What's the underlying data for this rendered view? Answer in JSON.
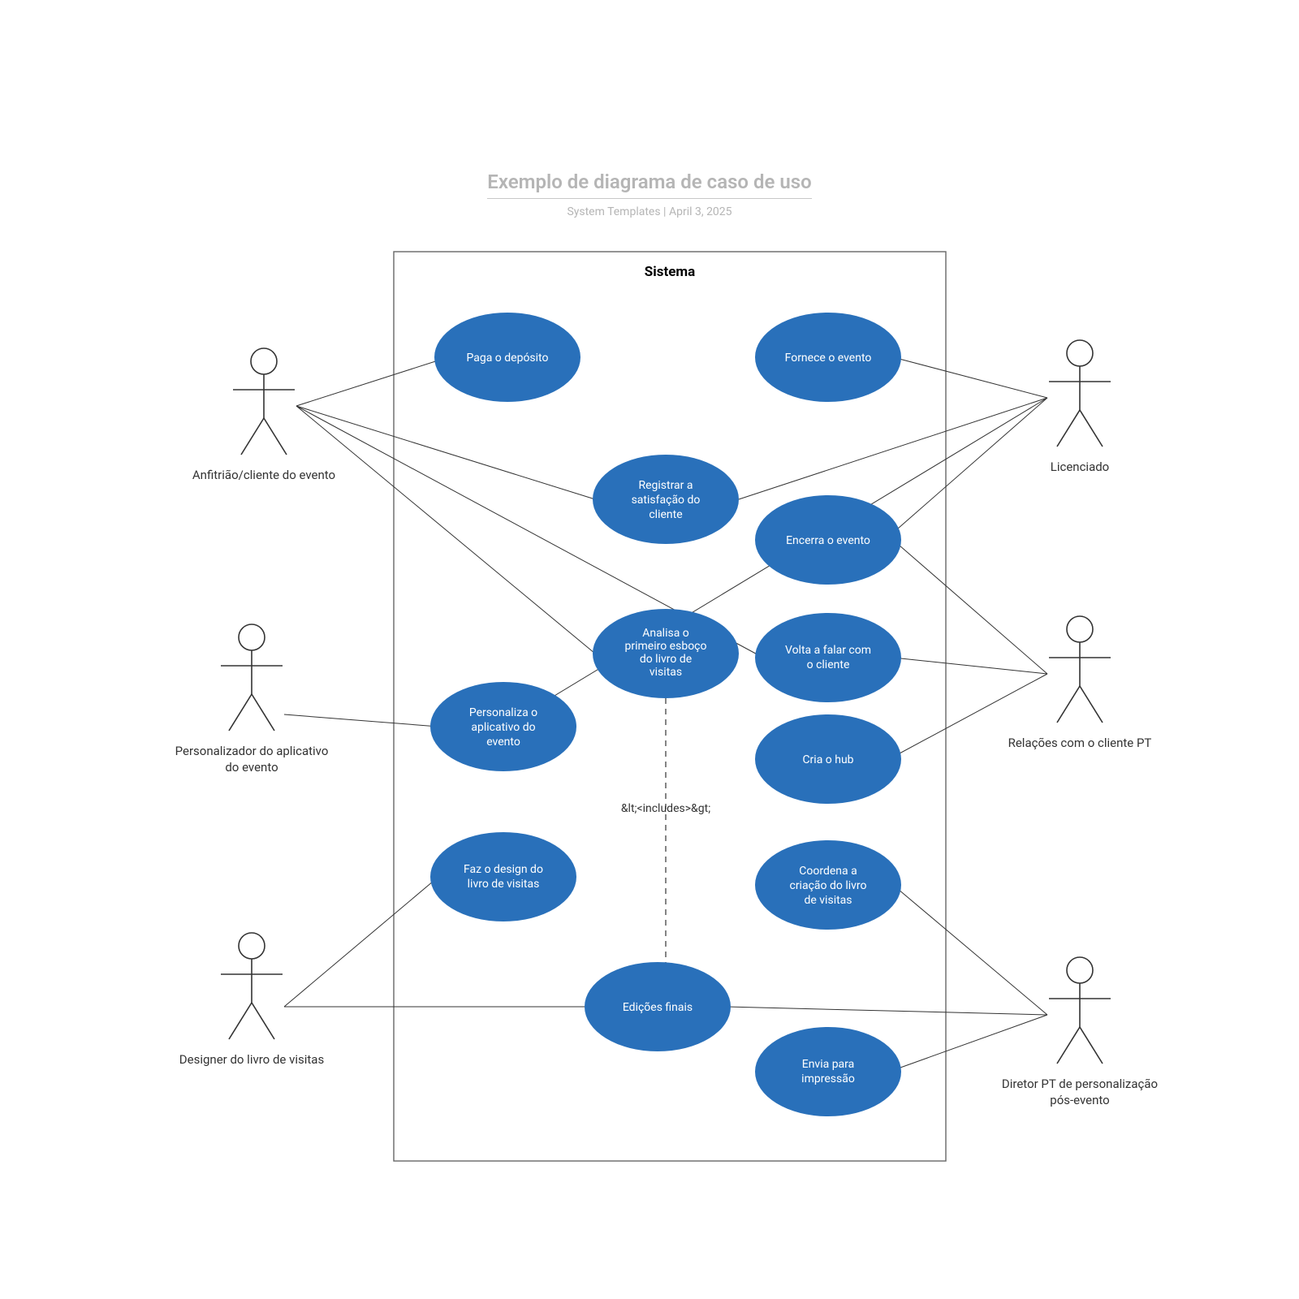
{
  "header": {
    "title": "Exemplo de diagrama de caso de uso",
    "subtitle_left": "System Templates",
    "subtitle_sep": "  |  ",
    "subtitle_right": "April 3, 2025"
  },
  "system_label": "Sistema",
  "includes_label": "&lt;<includes>&gt;",
  "colors": {
    "usecase_fill": "#2970ba",
    "stroke": "#333"
  },
  "actors": {
    "host": "Anfitrião/cliente do evento",
    "customizer_l1": "Personalizador do aplicativo",
    "customizer_l2": "do evento",
    "designer": "Designer do livro de visitas",
    "licensee": "Licenciado",
    "relations": "Relações com o cliente PT",
    "director_l1": "Diretor PT de personalização",
    "director_l2": "pós-evento"
  },
  "usecases": {
    "pay": "Paga o depósito",
    "provide": "Fornece o evento",
    "register_l1": "Registrar a",
    "register_l2": "satisfação do",
    "register_l3": "cliente",
    "close": "Encerra o evento",
    "review_l1": "Analisa o",
    "review_l2": "primeiro esboço",
    "review_l3": "do livro de",
    "review_l4": "visitas",
    "followup_l1": "Volta a falar com",
    "followup_l2": "o cliente",
    "customize_l1": "Personaliza o",
    "customize_l2": "aplicativo do",
    "customize_l3": "evento",
    "hub": "Cria o hub",
    "design_l1": "Faz o design do",
    "design_l2": "livro de visitas",
    "coord_l1": "Coordena a",
    "coord_l2": "criação do livro",
    "coord_l3": "de visitas",
    "final": "Edições finais",
    "print_l1": "Envia para",
    "print_l2": "impressão"
  }
}
